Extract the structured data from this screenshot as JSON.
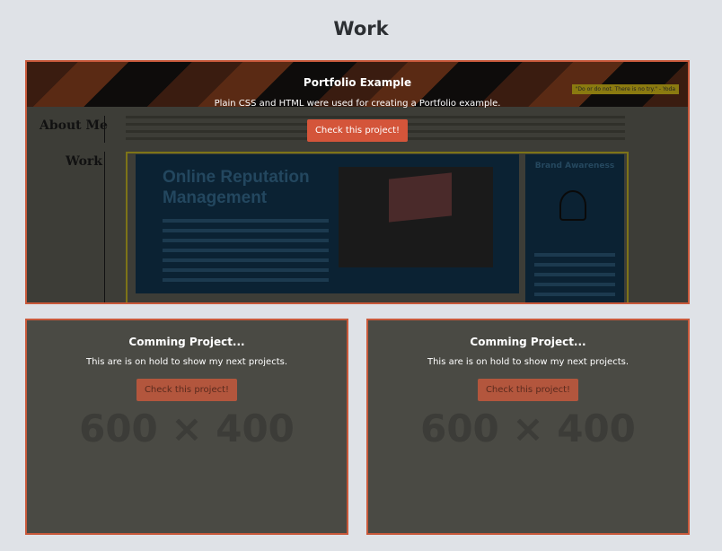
{
  "section": {
    "title": "Work"
  },
  "featured": {
    "title": "Portfolio Example",
    "description": "Plain CSS and HTML were used for creating a Portfolio example.",
    "button_label": "Check this project!",
    "preview": {
      "about_label": "About Me",
      "work_label": "Work",
      "quote": "\"Do or do not. There is no try.\" - Yoda",
      "orm_title_line1": "Online Reputation",
      "orm_title_line2": "Management",
      "brand_title": "Brand Awareness"
    }
  },
  "upcoming": [
    {
      "title": "Comming Project...",
      "description": "This are is on hold to show my next projects.",
      "button_label": "Check this project!",
      "placeholder": "600 × 400"
    },
    {
      "title": "Comming Project...",
      "description": "This are is on hold to show my next projects.",
      "button_label": "Check this project!",
      "placeholder": "600 × 400"
    }
  ],
  "colors": {
    "page_bg": "#dfe2e7",
    "accent": "#d4553a",
    "card_border": "#c8593b",
    "card_overlay": "#4a4a44"
  }
}
